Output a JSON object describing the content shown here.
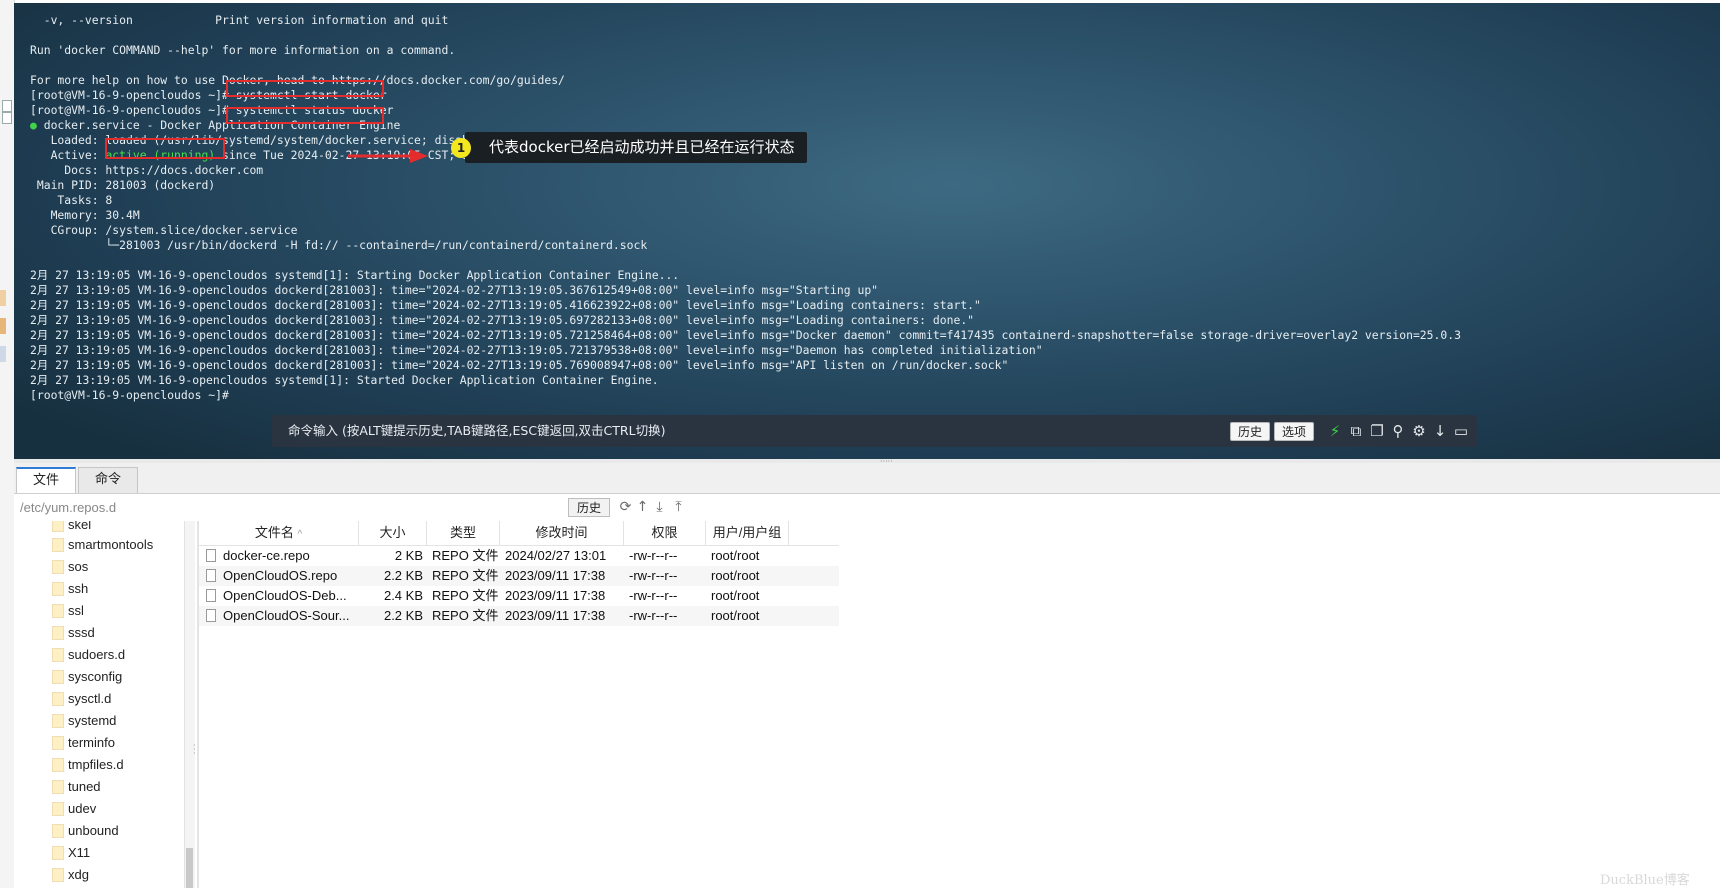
{
  "terminal": {
    "lines": [
      "  -v, --version            Print version information and quit",
      "",
      "Run 'docker COMMAND --help' for more information on a command.",
      "",
      "For more help on how to use Docker, head to https://docs.docker.com/go/guides/",
      "[root@VM-16-9-opencloudos ~]# systemctl start docker",
      "[root@VM-16-9-opencloudos ~]# systemctl status docker",
      "",
      "   Loaded: loaded (/usr/lib/systemd/system/docker.service; disabled; vendor preset: disabled)",
      "",
      "     Docs: https://docs.docker.com",
      " Main PID: 281003 (dockerd)",
      "    Tasks: 8",
      "   Memory: 30.4M",
      "   CGroup: /system.slice/docker.service",
      "           └─281003 /usr/bin/dockerd -H fd:// --containerd=/run/containerd/containerd.sock",
      "",
      "2月 27 13:19:05 VM-16-9-opencloudos systemd[1]: Starting Docker Application Container Engine...",
      "2月 27 13:19:05 VM-16-9-opencloudos dockerd[281003]: time=\"2024-02-27T13:19:05.367612549+08:00\" level=info msg=\"Starting up\"",
      "2月 27 13:19:05 VM-16-9-opencloudos dockerd[281003]: time=\"2024-02-27T13:19:05.416623922+08:00\" level=info msg=\"Loading containers: start.\"",
      "2月 27 13:19:05 VM-16-9-opencloudos dockerd[281003]: time=\"2024-02-27T13:19:05.697282133+08:00\" level=info msg=\"Loading containers: done.\"",
      "2月 27 13:19:05 VM-16-9-opencloudos dockerd[281003]: time=\"2024-02-27T13:19:05.721258464+08:00\" level=info msg=\"Docker daemon\" commit=f417435 containerd-snapshotter=false storage-driver=overlay2 version=25.0.3",
      "2月 27 13:19:05 VM-16-9-opencloudos dockerd[281003]: time=\"2024-02-27T13:19:05.721379538+08:00\" level=info msg=\"Daemon has completed initialization\"",
      "2月 27 13:19:05 VM-16-9-opencloudos dockerd[281003]: time=\"2024-02-27T13:19:05.769008947+08:00\" level=info msg=\"API listen on /run/docker.sock\"",
      "2月 27 13:19:05 VM-16-9-opencloudos systemd[1]: Started Docker Application Container Engine.",
      "[root@VM-16-9-opencloudos ~]#"
    ],
    "service_dot": "●",
    "service_line": " docker.service - Docker Application Container Engine",
    "active_prefix": "   Active: ",
    "active_status": "active (running)",
    "active_suffix": " since Tue 2024-02-27 13:19:05 CST; 14s ago",
    "status_color": "#45e04a"
  },
  "annotation": {
    "number": "1",
    "text": "代表docker已经启动成功并且已经在运行状态",
    "box_color": "#e52c2c"
  },
  "command_bar": {
    "placeholder": "命令输入 (按ALT键提示历史,TAB键路径,ESC键返回,双击CTRL切换)",
    "history_button": "历史",
    "options_button": "选项",
    "icons": [
      "lightning-icon",
      "copy-icon",
      "paste-icon",
      "search-icon",
      "gear-icon",
      "download-icon",
      "window-icon"
    ]
  },
  "tabs": [
    {
      "label": "文件",
      "active": true
    },
    {
      "label": "命令",
      "active": false
    }
  ],
  "path_bar": {
    "path": "/etc/yum.repos.d",
    "history_button": "历史",
    "icons": [
      "refresh-icon",
      "up-dir-icon",
      "download-icon",
      "upload-icon"
    ]
  },
  "tree": {
    "items": [
      "skel",
      "smartmontools",
      "sos",
      "ssh",
      "ssl",
      "sssd",
      "sudoers.d",
      "sysconfig",
      "sysctl.d",
      "systemd",
      "terminfo",
      "tmpfiles.d",
      "tuned",
      "udev",
      "unbound",
      "X11",
      "xdg"
    ]
  },
  "file_table": {
    "columns": [
      "文件名",
      "大小",
      "类型",
      "修改时间",
      "权限",
      "用户/用户组"
    ],
    "sort_indicator": "^",
    "rows": [
      {
        "name": "docker-ce.repo",
        "size": "2 KB",
        "type": "REPO 文件",
        "mtime": "2024/02/27 13:01",
        "perm": "-rw-r--r--",
        "owner": "root/root"
      },
      {
        "name": "OpenCloudOS.repo",
        "size": "2.2 KB",
        "type": "REPO 文件",
        "mtime": "2023/09/11 17:38",
        "perm": "-rw-r--r--",
        "owner": "root/root"
      },
      {
        "name": "OpenCloudOS-Deb...",
        "size": "2.4 KB",
        "type": "REPO 文件",
        "mtime": "2023/09/11 17:38",
        "perm": "-rw-r--r--",
        "owner": "root/root"
      },
      {
        "name": "OpenCloudOS-Sour...",
        "size": "2.2 KB",
        "type": "REPO 文件",
        "mtime": "2023/09/11 17:38",
        "perm": "-rw-r--r--",
        "owner": "root/root"
      }
    ]
  },
  "watermark": "DuckBlue博客"
}
